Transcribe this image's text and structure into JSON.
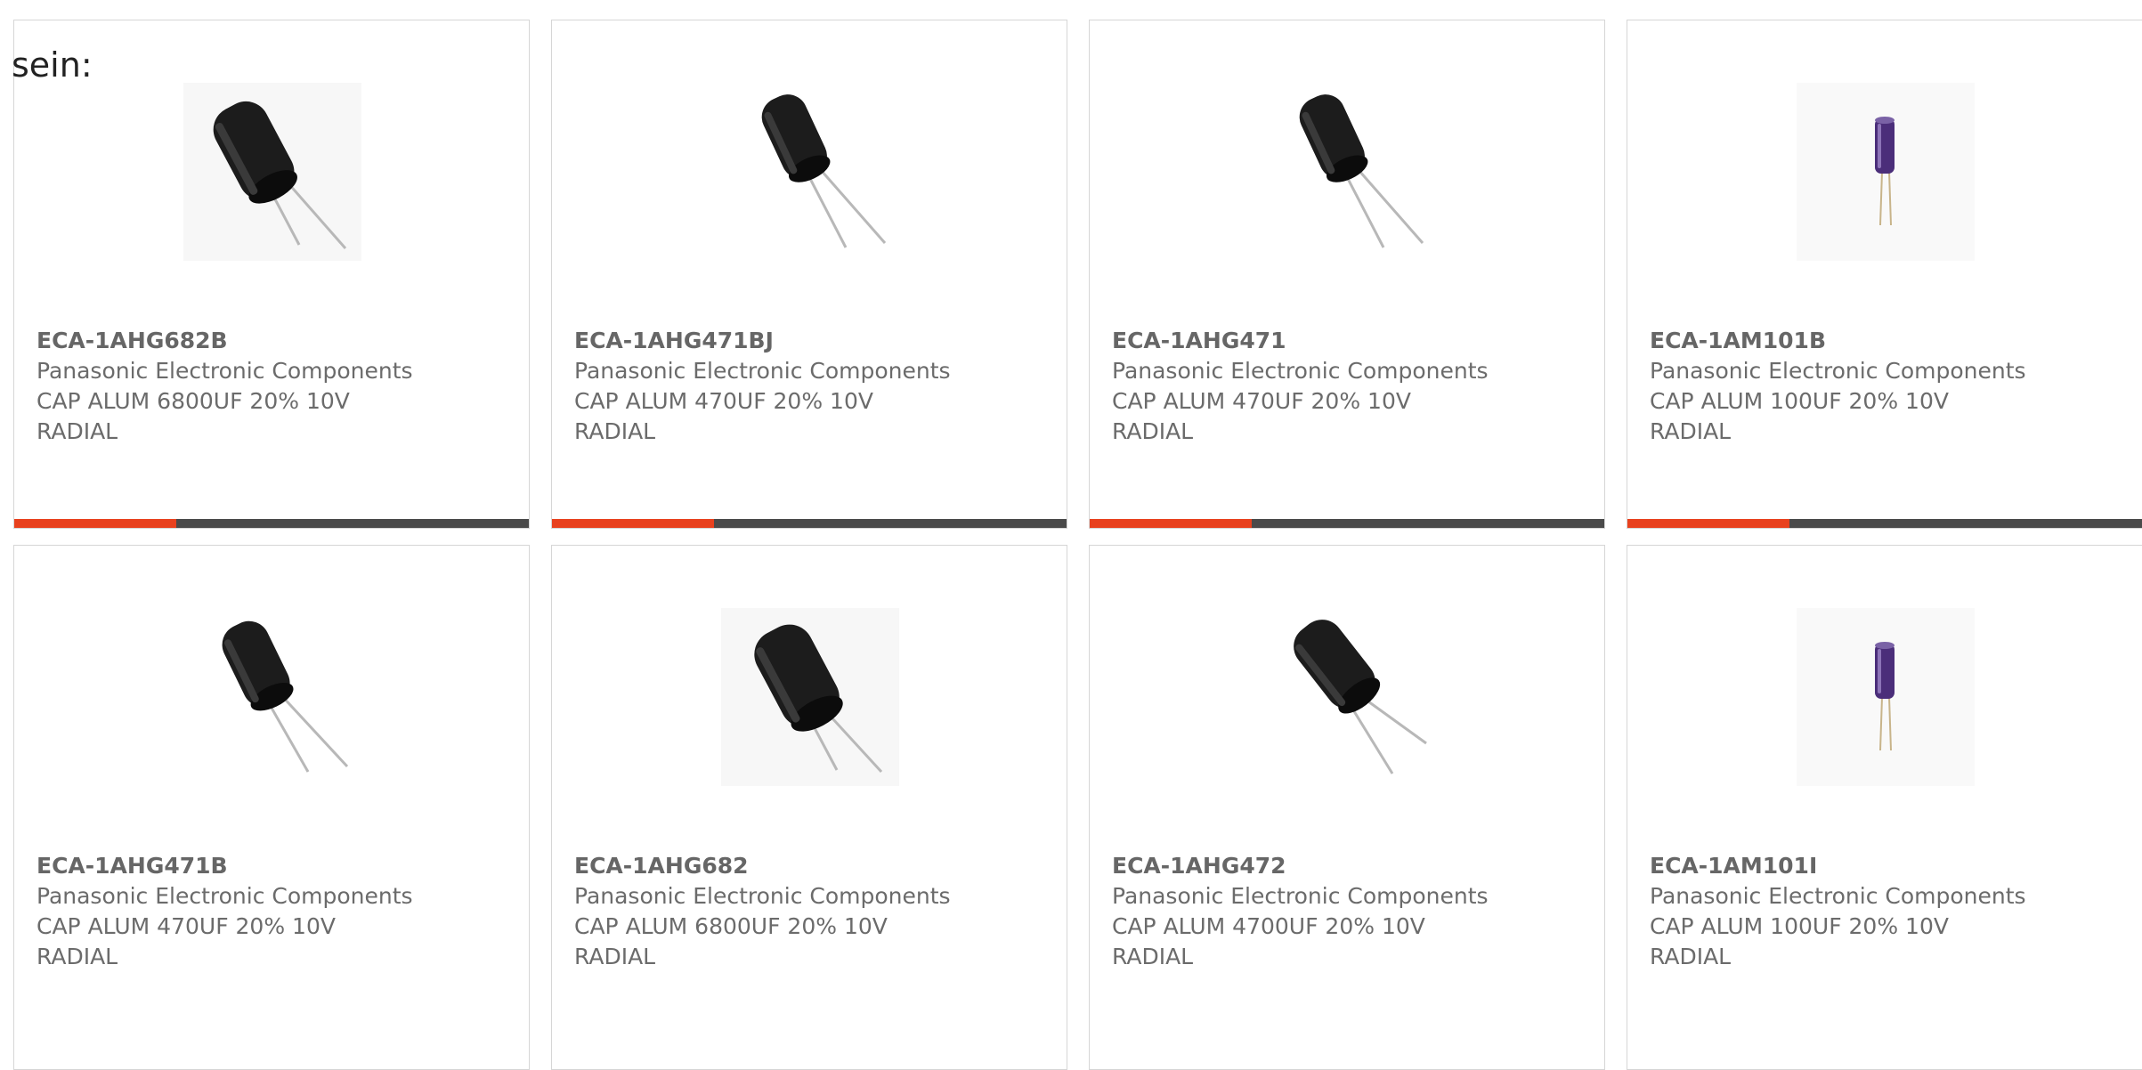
{
  "lead_text": "sein:",
  "accent_color": "#e8411e",
  "products": [
    {
      "part_number": "ECA-1AHG682B",
      "manufacturer": "Panasonic Electronic Components",
      "desc_line1": "CAP ALUM 6800UF 20% 10V",
      "desc_line2": "RADIAL",
      "image": "black-radial-capacitor"
    },
    {
      "part_number": "ECA-1AHG471BJ",
      "manufacturer": "Panasonic Electronic Components",
      "desc_line1": "CAP ALUM 470UF 20% 10V",
      "desc_line2": "RADIAL",
      "image": "black-radial-capacitor"
    },
    {
      "part_number": "ECA-1AHG471",
      "manufacturer": "Panasonic Electronic Components",
      "desc_line1": "CAP ALUM 470UF 20% 10V",
      "desc_line2": "RADIAL",
      "image": "black-radial-capacitor"
    },
    {
      "part_number": "ECA-1AM101B",
      "manufacturer": "Panasonic Electronic Components",
      "desc_line1": "CAP ALUM 100UF 20% 10V",
      "desc_line2": "RADIAL",
      "image": "purple-radial-capacitor"
    },
    {
      "part_number": "ECA-1AHG471B",
      "manufacturer": "Panasonic Electronic Components",
      "desc_line1": "CAP ALUM 470UF 20% 10V",
      "desc_line2": "RADIAL",
      "image": "black-radial-capacitor"
    },
    {
      "part_number": "ECA-1AHG682",
      "manufacturer": "Panasonic Electronic Components",
      "desc_line1": "CAP ALUM 6800UF 20% 10V",
      "desc_line2": "RADIAL",
      "image": "black-radial-capacitor"
    },
    {
      "part_number": "ECA-1AHG472",
      "manufacturer": "Panasonic Electronic Components",
      "desc_line1": "CAP ALUM 4700UF 20% 10V",
      "desc_line2": "RADIAL",
      "image": "black-radial-capacitor"
    },
    {
      "part_number": "ECA-1AM101I",
      "manufacturer": "Panasonic Electronic Components",
      "desc_line1": "CAP ALUM 100UF 20% 10V",
      "desc_line2": "RADIAL",
      "image": "purple-radial-capacitor"
    }
  ]
}
